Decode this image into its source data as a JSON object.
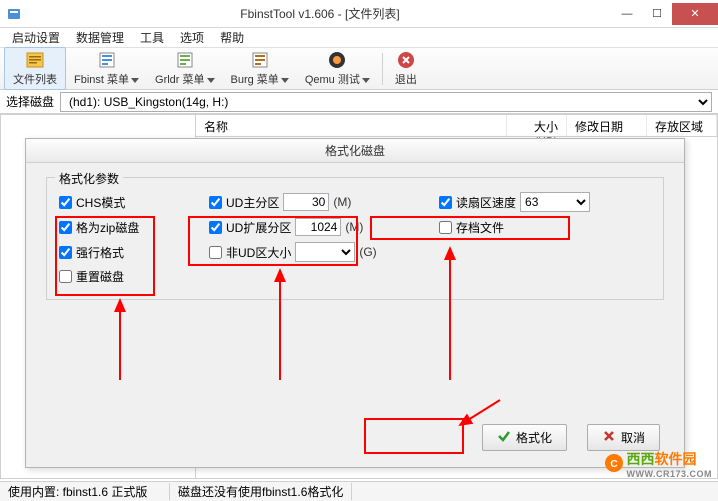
{
  "window": {
    "title": "FbinstTool v1.606 - [文件列表]",
    "min": "—",
    "max": "☐",
    "close": "✕"
  },
  "menu": {
    "items": [
      "启动设置",
      "数据管理",
      "工具",
      "选项",
      "帮助"
    ]
  },
  "toolbar": {
    "file_list": "文件列表",
    "fbinst_menu": "Fbinst 菜单",
    "grldr_menu": "Grldr 菜单",
    "burg_menu": "Burg 菜单",
    "qemu_test": "Qemu 测试",
    "exit": "退出"
  },
  "diskrow": {
    "label": "选择磁盘",
    "value": "(hd1): USB_Kingston(14g, H:)"
  },
  "columns": {
    "name": "名称",
    "size": "大小(KB)",
    "date": "修改日期",
    "location": "存放区域"
  },
  "dialog": {
    "title": "格式化磁盘",
    "legend": "格式化参数",
    "chs_mode": "CHS模式",
    "zip_disk": "格为zip磁盘",
    "force_format": "强行格式",
    "reset_disk": "重置磁盘",
    "ud_main": "UD主分区",
    "ud_main_val": "30",
    "ud_main_unit": "(M)",
    "ud_ext": "UD扩展分区",
    "ud_ext_val": "1024",
    "ud_ext_unit": "(M)",
    "non_ud_size": "非UD区大小",
    "non_ud_unit": "(G)",
    "sector_speed": "读扇区速度",
    "sector_speed_val": "63",
    "archive_file": "存档文件",
    "btn_format": "格式化",
    "btn_cancel": "取消"
  },
  "status": {
    "left": "使用内置: fbinst1.6 正式版",
    "center": "磁盘还没有使用fbinst1.6格式化"
  },
  "watermark": {
    "brand1": "西西",
    "brand2": "软件园",
    "url": "WWW.CR173.COM"
  }
}
